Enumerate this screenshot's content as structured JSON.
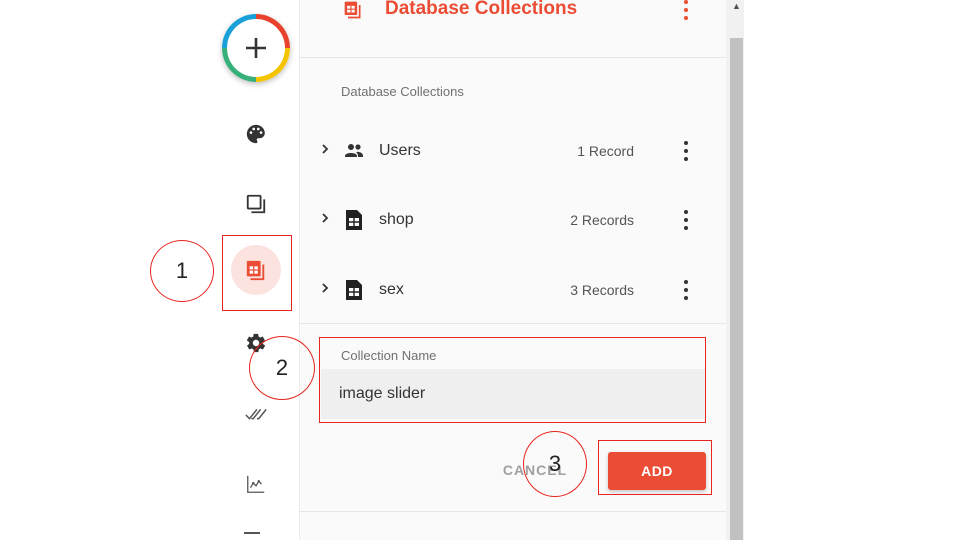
{
  "panel": {
    "title": "Database Collections",
    "section_label": "Database Collections"
  },
  "rail": {
    "items": [
      {
        "icon": "palette-icon"
      },
      {
        "icon": "layers-icon"
      },
      {
        "icon": "database-icon",
        "active": true
      },
      {
        "icon": "gear-icon"
      },
      {
        "icon": "double-check-icon"
      },
      {
        "icon": "analytics-icon"
      }
    ]
  },
  "collections": [
    {
      "name": "Users",
      "count": "1 Record",
      "icon": "users-icon"
    },
    {
      "name": "shop",
      "count": "2 Records",
      "icon": "table-icon"
    },
    {
      "name": "sex",
      "count": "3 Records",
      "icon": "table-icon"
    }
  ],
  "form": {
    "label": "Collection Name",
    "value": "image slider",
    "cancel_label": "CANCEL",
    "add_label": "ADD"
  },
  "annotations": [
    "1",
    "2",
    "3"
  ],
  "colors": {
    "accent": "#ea4c34",
    "annotation": "#e8251e",
    "active_bg": "#fde3e0"
  }
}
